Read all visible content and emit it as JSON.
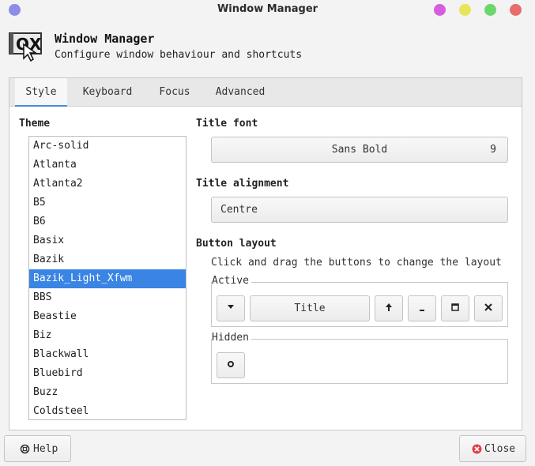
{
  "window": {
    "title": "Window Manager"
  },
  "header": {
    "title": "Window Manager",
    "subtitle": "Configure window behaviour and shortcuts"
  },
  "tabs": [
    {
      "label": "Style",
      "active": true
    },
    {
      "label": "Keyboard",
      "active": false
    },
    {
      "label": "Focus",
      "active": false
    },
    {
      "label": "Advanced",
      "active": false
    }
  ],
  "theme": {
    "label": "Theme",
    "items": [
      "Arc-solid",
      "Atlanta",
      "Atlanta2",
      "B5",
      "B6",
      "Basix",
      "Bazik",
      "Bazik_Light_Xfwm",
      "BBS",
      "Beastie",
      "Biz",
      "Blackwall",
      "Bluebird",
      "Buzz",
      "Coldsteel"
    ],
    "selected": "Bazik_Light_Xfwm"
  },
  "title_font": {
    "label": "Title font",
    "font_name": "Sans Bold",
    "font_size": "9"
  },
  "title_alignment": {
    "label": "Title alignment",
    "value": "Centre"
  },
  "button_layout": {
    "label": "Button layout",
    "hint": "Click and drag the buttons to change the layout",
    "active_label": "Active",
    "title_button": "Title",
    "hidden_label": "Hidden"
  },
  "bottom": {
    "help_label": "Help",
    "close_label": "Close"
  },
  "colors": {
    "accent": "#3a84e4",
    "window_dot_app": "#8e8ce6",
    "window_dot_magenta": "#d65ce0",
    "window_dot_yellow": "#e6e65a",
    "window_dot_green": "#6cd66c",
    "window_dot_red": "#e86c6c",
    "close_icon": "#e0414b"
  },
  "icons": {
    "app": "window-manager-icon",
    "shade": "arrow-down-icon",
    "stick": "arrow-up-icon",
    "minimize": "minimize-icon",
    "maximize": "maximize-icon",
    "close": "close-icon",
    "hidden": "stick-dot-icon",
    "help": "help-lifebuoy-icon",
    "close_bottom": "close-circle-icon"
  }
}
